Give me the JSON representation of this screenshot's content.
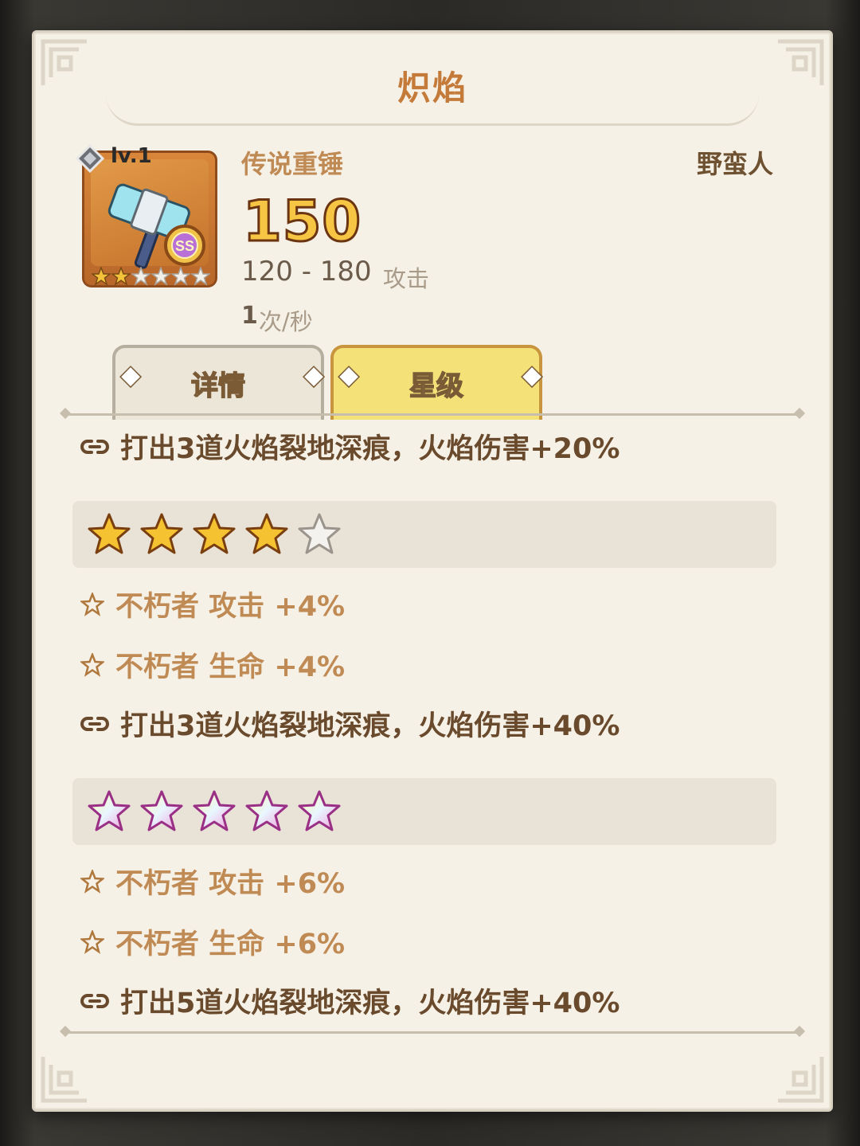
{
  "title": "炽焰",
  "item": {
    "level": "lv.1",
    "rarity_badge": "SS",
    "type": "传说重锤",
    "class": "野蛮人",
    "attack_value": "150",
    "attack_range": "120 - 180",
    "attack_label": "攻击",
    "speed_value": "1",
    "speed_unit": "次/秒",
    "star_rating": 2,
    "max_stars": 6
  },
  "tabs": {
    "details": "详情",
    "stars": "星级",
    "active": "stars"
  },
  "star_sections": {
    "top_line": "打出3道火焰裂地深痕，火焰伤害+20%",
    "tier4": {
      "stars": "4 of 5 gold",
      "attack": "不朽者 攻击 +4%",
      "hp": "不朽者 生命 +4%",
      "effect": "打出3道火焰裂地深痕，火焰伤害+40%"
    },
    "tier5": {
      "stars": "5 of 5 rainbow",
      "attack": "不朽者 攻击 +6%",
      "hp": "不朽者 生命 +6%",
      "effect": "打出5道火焰裂地深痕，火焰伤害+40%"
    }
  },
  "icons": {
    "link": "link-icon",
    "bonus_star": "outline-star-icon",
    "gold_star": "gold-star-icon",
    "silver_star": "silver-star-icon",
    "rainbow_star": "rainbow-star-icon"
  },
  "colors": {
    "title": "#c47a38",
    "panel": "#f6f1e6",
    "active_tab": "#f4e279",
    "gold_number": "#f7c544"
  }
}
